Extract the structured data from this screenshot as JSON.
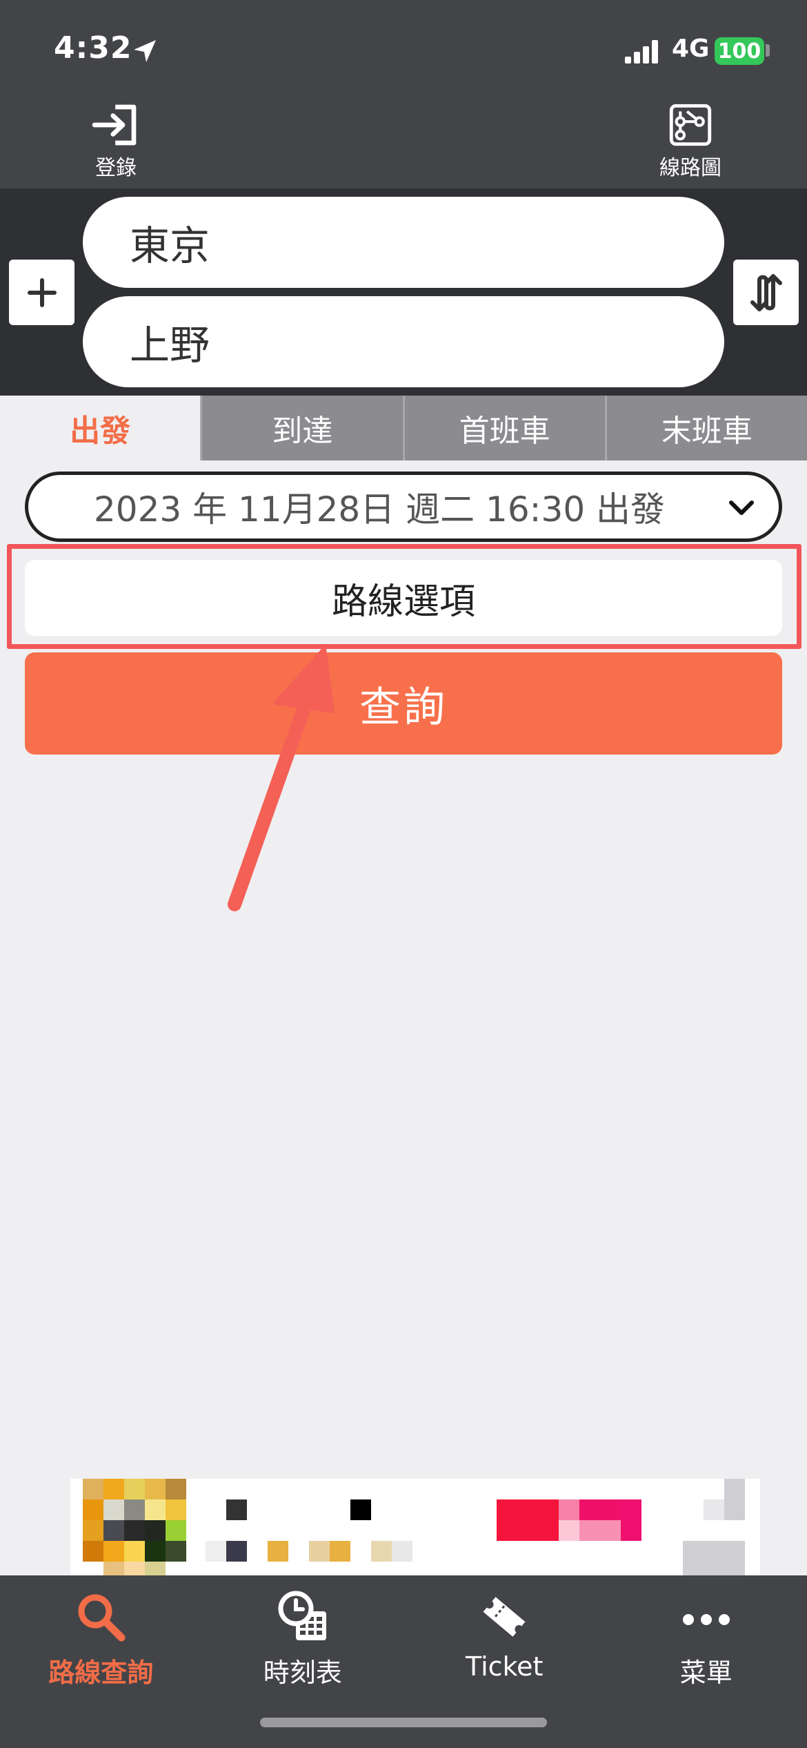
{
  "status_bar": {
    "time": "4:32",
    "network": "4G",
    "battery": "100"
  },
  "header": {
    "login_label": "登錄",
    "route_map_label": "線路圖"
  },
  "stations": {
    "from_value": "東京",
    "to_value": "上野"
  },
  "tabs": [
    {
      "label": "出發",
      "active": true
    },
    {
      "label": "到達",
      "active": false
    },
    {
      "label": "首班車",
      "active": false
    },
    {
      "label": "末班車",
      "active": false
    }
  ],
  "date_picker": {
    "value": "2023 年 11月28日 週二 16:30 出發"
  },
  "route_options": {
    "label": "路線選項"
  },
  "search": {
    "label": "查詢"
  },
  "bottom_nav": [
    {
      "label": "路線查詢",
      "icon": "search-icon",
      "active": true
    },
    {
      "label": "時刻表",
      "icon": "timetable-icon",
      "active": false
    },
    {
      "label": "Ticket",
      "icon": "ticket-icon",
      "active": false
    },
    {
      "label": "菜單",
      "icon": "more-icon",
      "active": false
    }
  ],
  "colors": {
    "accent": "#f7704b",
    "header_bg": "#434448",
    "station_bg": "#2f3033",
    "highlight": "#f2565a"
  }
}
